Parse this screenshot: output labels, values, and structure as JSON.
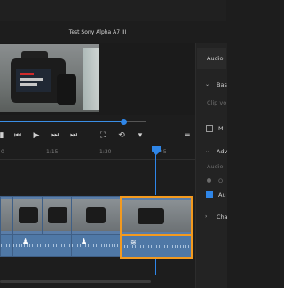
{
  "window": {
    "title": "Test Sony Alpha A7 III"
  },
  "timeline": {
    "ruler": [
      "0",
      "1:15",
      "1:30",
      "45"
    ]
  },
  "panel": {
    "tab": "Audio",
    "section_basic": "Bas",
    "clip_row": "Clip vo",
    "mute_row": "M",
    "section_advanced": "Adv",
    "audio_row": "Audio",
    "option_a": "O",
    "option_b": "Au",
    "section_channels": "Cha"
  },
  "colors": {
    "accent": "#2f86e8",
    "selection": "#f39a1f",
    "clip": "#5a7da8"
  }
}
